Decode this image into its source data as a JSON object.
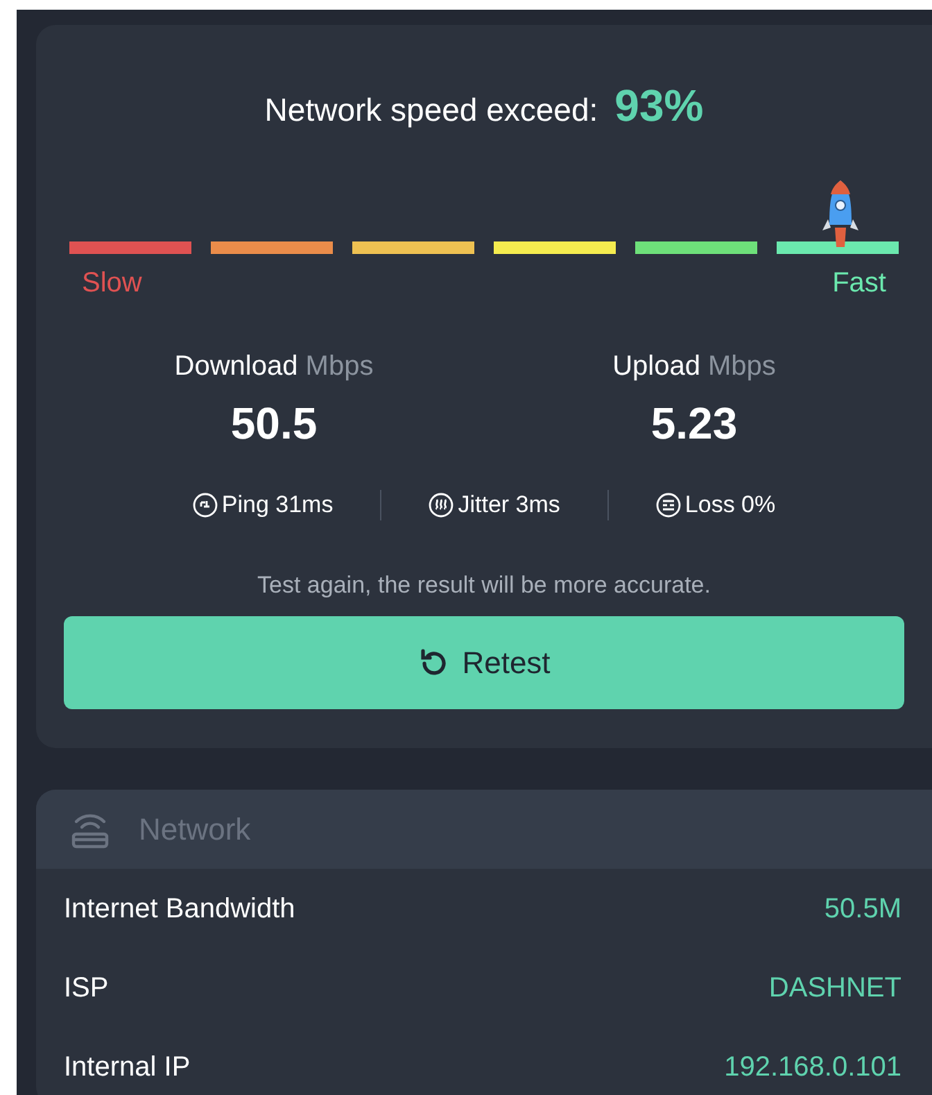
{
  "headline": {
    "label": "Network speed exceed:",
    "value": "93%"
  },
  "gauge": {
    "level": 0.93,
    "segments": [
      {
        "color": "#e05252"
      },
      {
        "color": "#ea8c4a"
      },
      {
        "color": "#eec152"
      },
      {
        "color": "#f5ec4f"
      },
      {
        "color": "#6ee07a"
      },
      {
        "color": "#6be8ae"
      }
    ],
    "low_label": "Slow",
    "high_label": "Fast"
  },
  "speeds": [
    {
      "label": "Download",
      "unit": "Mbps",
      "value": "50.5"
    },
    {
      "label": "Upload",
      "unit": "Mbps",
      "value": "5.23"
    }
  ],
  "stats": [
    {
      "kind": "ping",
      "text": "Ping 31ms"
    },
    {
      "kind": "jitter",
      "text": "Jitter 3ms"
    },
    {
      "kind": "loss",
      "text": "Loss 0%"
    }
  ],
  "hint": "Test again, the result will be more accurate.",
  "retest_button": "Retest",
  "network": {
    "title": "Network",
    "rows": [
      {
        "label": "Internet Bandwidth",
        "value": "50.5M"
      },
      {
        "label": "ISP",
        "value": "DASHNET"
      },
      {
        "label": "Internal IP",
        "value": "192.168.0.101"
      }
    ]
  }
}
